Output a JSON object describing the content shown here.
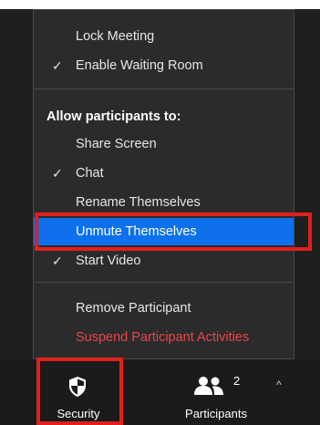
{
  "menu": {
    "lock_meeting": "Lock Meeting",
    "enable_waiting_room": "Enable Waiting Room",
    "allow_heading": "Allow participants to:",
    "share_screen": "Share Screen",
    "chat": "Chat",
    "rename_themselves": "Rename Themselves",
    "unmute_themselves": "Unmute Themselves",
    "start_video": "Start Video",
    "remove_participant": "Remove Participant",
    "suspend_participant_activities": "Suspend Participant Activities",
    "checkmark": "✓"
  },
  "toolbar": {
    "security_label": "Security",
    "participants_label": "Participants",
    "participants_count": "2",
    "caret": "^"
  },
  "colors": {
    "highlight": "#0e71eb",
    "danger": "#e8474a",
    "annotation_red": "#e0201d",
    "menu_bg": "#2b2b2b"
  },
  "icons": {
    "security": "shield-icon",
    "participants": "people-icon",
    "caret": "caret-up-icon"
  }
}
